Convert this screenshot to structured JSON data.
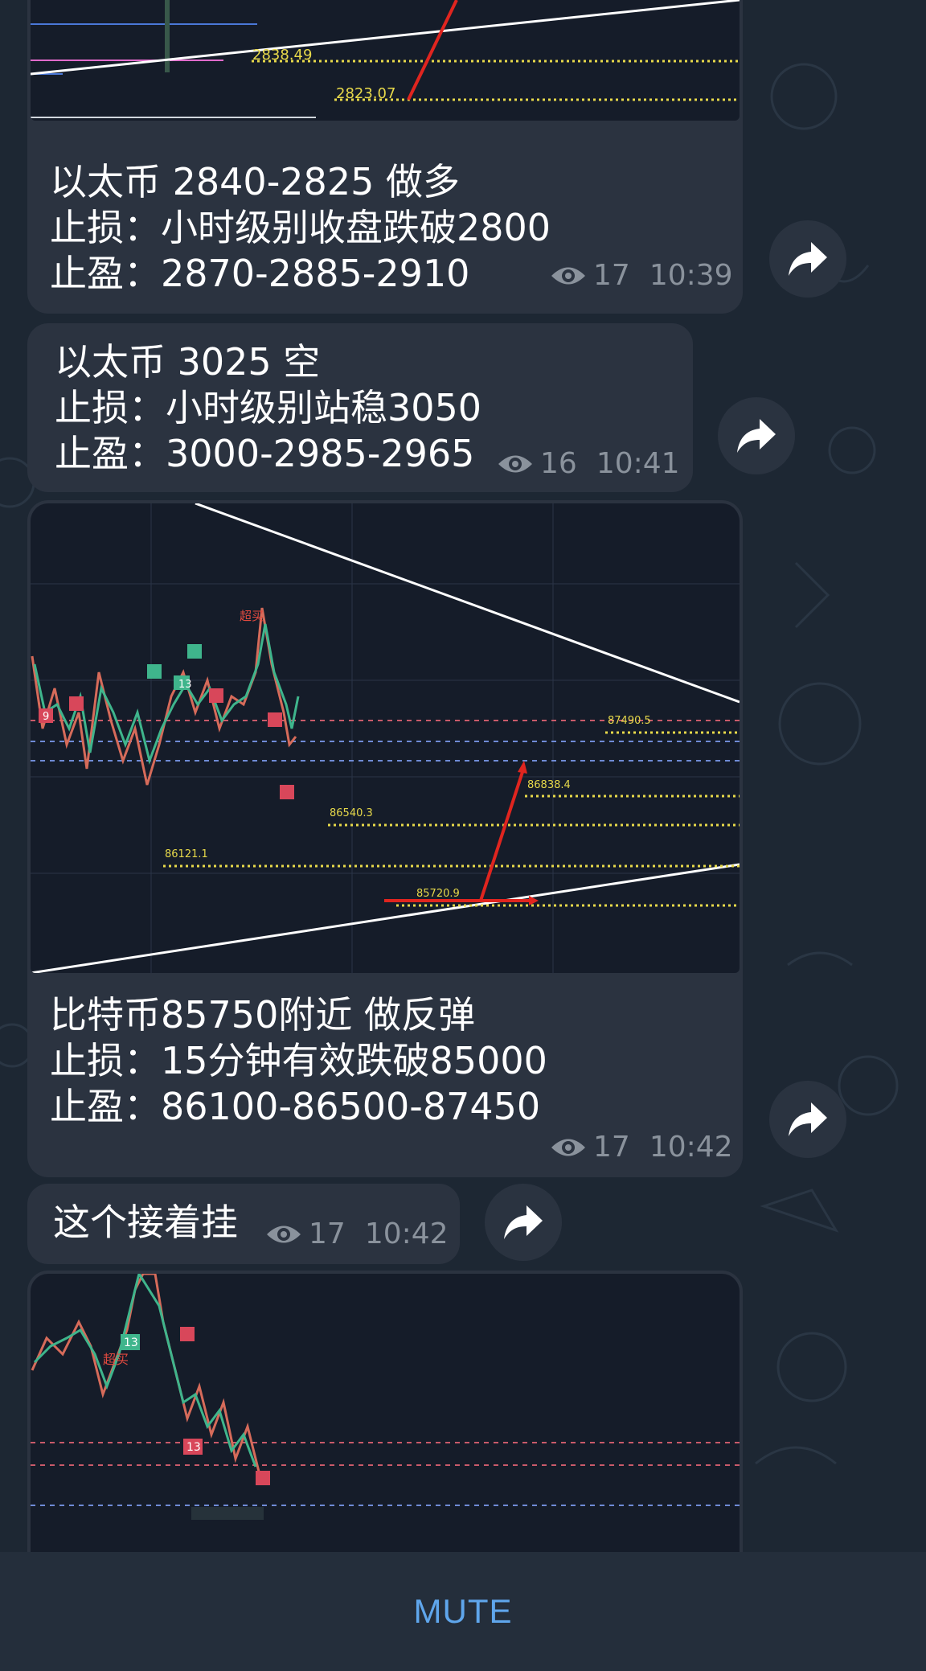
{
  "messages": [
    {
      "chart_labels": [
        "2838.49",
        "2823.07"
      ],
      "lines": [
        "以太币 2840-2825 做多",
        "止损：小时级别收盘跌破2800",
        "止盈：2870-2885-2910"
      ],
      "views": "17",
      "time": "10:39"
    },
    {
      "lines": [
        "以太币 3025 空",
        "止损：小时级别站稳3050",
        "止盈：3000-2985-2965"
      ],
      "views": "16",
      "time": "10:41"
    },
    {
      "chart_labels": [
        "87490.5",
        "86838.4",
        "86540.3",
        "86121.1",
        "85720.9"
      ],
      "lines": [
        "比特币85750附近 做反弹",
        "止损：15分钟有效跌破85000",
        "止盈：86100-86500-87450"
      ],
      "views": "17",
      "time": "10:42"
    },
    {
      "lines": [
        "这个接着挂"
      ],
      "views": "17",
      "time": "10:42"
    }
  ],
  "chart_badges": {
    "nine": "9",
    "thirteen": "13",
    "chinese": "超买"
  },
  "icons": {
    "views": "eye-icon",
    "forward": "forward-arrow-icon"
  },
  "colors": {
    "background": "#1d2733",
    "bubble": "#2b3340",
    "chart_bg": "#151c29",
    "accent": "#5fa6ec",
    "level_line": "#e7d94a",
    "trend_arrow": "#e0251f"
  },
  "bottom_bar": {
    "mute_label": "MUTE"
  }
}
